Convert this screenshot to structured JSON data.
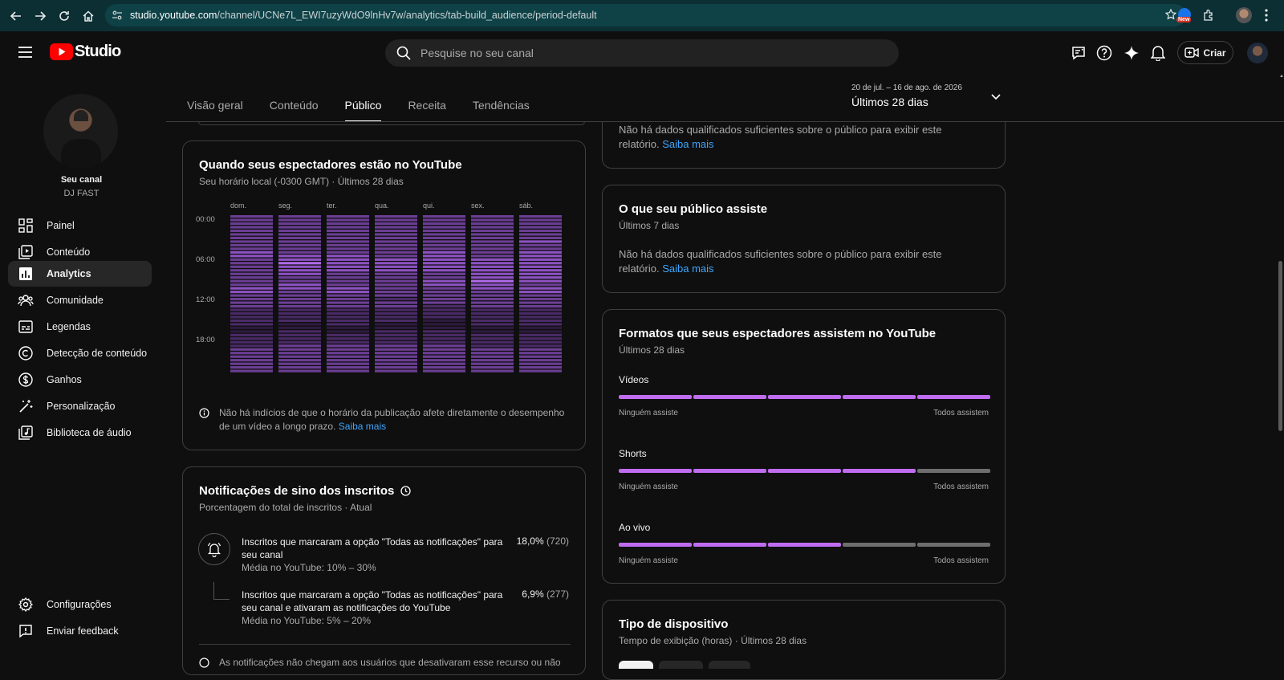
{
  "browser": {
    "url_host": "studio.youtube.com",
    "url_path": "/channel/UCNe7L_EWI7uzyWdO9lnHv7w/analytics/tab-build_audience/period-default",
    "ext_badge": "New"
  },
  "header": {
    "logo_text": "Studio",
    "search_placeholder": "Pesquise no seu canal",
    "create_label": "Criar"
  },
  "channel": {
    "label": "Seu canal",
    "name": "DJ FAST"
  },
  "sidebar": {
    "items": [
      {
        "label": "Painel",
        "icon": "dashboard-icon"
      },
      {
        "label": "Conteúdo",
        "icon": "content-icon"
      },
      {
        "label": "Analytics",
        "icon": "analytics-icon",
        "active": true
      },
      {
        "label": "Comunidade",
        "icon": "community-icon"
      },
      {
        "label": "Legendas",
        "icon": "subtitles-icon"
      },
      {
        "label": "Detecção de conteúdo",
        "icon": "copyright-icon"
      },
      {
        "label": "Ganhos",
        "icon": "earn-icon"
      },
      {
        "label": "Personalização",
        "icon": "customization-icon"
      },
      {
        "label": "Biblioteca de áudio",
        "icon": "audio-library-icon"
      }
    ],
    "bottom": [
      {
        "label": "Configurações",
        "icon": "settings-icon"
      },
      {
        "label": "Enviar feedback",
        "icon": "feedback-icon"
      }
    ]
  },
  "tabs": [
    {
      "label": "Visão geral"
    },
    {
      "label": "Conteúdo"
    },
    {
      "label": "Público",
      "active": true
    },
    {
      "label": "Receita"
    },
    {
      "label": "Tendências"
    }
  ],
  "period": {
    "range": "20 de jul. – 16 de ago. de 2026",
    "label": "Últimos 28 dias"
  },
  "when_card": {
    "title": "Quando seus espectadores estão no YouTube",
    "subtitle": "Seu horário local (-0300 GMT) · Últimos 28 dias",
    "days": [
      "dom.",
      "seg.",
      "ter.",
      "qua.",
      "qui.",
      "sex.",
      "sáb."
    ],
    "hours": [
      "00:00",
      "06:00",
      "12:00",
      "18:00"
    ],
    "note": "Não há indícios de que o horário da publicação afete diretamente o desempenho de um vídeo a longo prazo.",
    "link": "Saiba mais"
  },
  "heatmap_levels": [
    [
      3,
      3,
      3,
      3,
      3,
      3,
      3,
      3,
      3,
      3,
      4,
      4,
      3,
      3,
      3,
      3,
      3,
      3,
      3,
      3,
      4,
      4,
      3,
      3,
      3,
      3,
      2,
      2,
      2,
      2,
      2,
      1,
      1,
      2,
      2,
      2,
      2,
      3,
      3,
      3,
      3,
      3,
      3,
      3
    ],
    [
      3,
      3,
      3,
      3,
      3,
      3,
      3,
      3,
      3,
      3,
      3,
      4,
      4,
      5,
      4,
      4,
      4,
      3,
      3,
      4,
      4,
      3,
      3,
      3,
      3,
      3,
      2,
      2,
      2,
      2,
      1,
      1,
      2,
      2,
      2,
      2,
      3,
      3,
      3,
      3,
      3,
      3,
      3,
      3
    ],
    [
      3,
      3,
      3,
      3,
      3,
      3,
      3,
      3,
      3,
      3,
      3,
      4,
      4,
      4,
      4,
      4,
      3,
      3,
      3,
      3,
      4,
      4,
      3,
      3,
      3,
      3,
      2,
      2,
      2,
      2,
      2,
      1,
      1,
      2,
      2,
      2,
      3,
      3,
      3,
      3,
      3,
      3,
      3,
      3
    ],
    [
      3,
      3,
      3,
      3,
      3,
      3,
      3,
      3,
      3,
      3,
      3,
      3,
      4,
      4,
      4,
      4,
      3,
      3,
      3,
      3,
      3,
      3,
      3,
      2,
      3,
      3,
      2,
      2,
      2,
      2,
      1,
      1,
      2,
      2,
      2,
      2,
      3,
      3,
      3,
      3,
      3,
      3,
      3,
      3
    ],
    [
      3,
      3,
      3,
      3,
      3,
      3,
      3,
      3,
      3,
      3,
      4,
      4,
      4,
      4,
      4,
      4,
      3,
      3,
      4,
      4,
      3,
      3,
      3,
      3,
      3,
      2,
      2,
      2,
      2,
      1,
      1,
      1,
      2,
      2,
      2,
      2,
      3,
      3,
      3,
      3,
      3,
      3,
      3,
      3
    ],
    [
      3,
      3,
      3,
      3,
      3,
      3,
      3,
      3,
      3,
      3,
      3,
      3,
      4,
      4,
      4,
      4,
      4,
      4,
      5,
      4,
      4,
      3,
      3,
      3,
      3,
      3,
      2,
      2,
      2,
      2,
      2,
      1,
      1,
      2,
      2,
      2,
      2,
      3,
      3,
      3,
      3,
      3,
      3,
      3
    ],
    [
      3,
      3,
      3,
      3,
      3,
      3,
      3,
      4,
      3,
      3,
      4,
      4,
      4,
      4,
      4,
      4,
      4,
      4,
      4,
      3,
      4,
      4,
      3,
      3,
      3,
      3,
      2,
      2,
      2,
      2,
      2,
      1,
      1,
      2,
      2,
      2,
      2,
      3,
      3,
      3,
      3,
      3,
      3,
      3
    ]
  ],
  "bell_card": {
    "title": "Notificações de sino dos inscritos",
    "subtitle": "Porcentagem do total de inscritos · Atual",
    "rows": [
      {
        "line1": "Inscritos que marcaram a opção \"Todas as notificações\" para",
        "line2": "seu canal",
        "avg": "Média no YouTube: 10% – 30%",
        "pct": "18,0%",
        "count": "(720)"
      },
      {
        "line1": "Inscritos que marcaram a opção \"Todas as notificações\" para",
        "line2": "seu canal e ativaram as notificações do YouTube",
        "avg": "Média no YouTube: 5% – 20%",
        "pct": "6,9%",
        "count": "(277)"
      }
    ],
    "footer": "As notificações não chegam aos usuários que desativaram esse recurso ou não"
  },
  "nodata_card1": {
    "text1": "Não há dados qualificados suficientes sobre o público para exibir este",
    "text2": "relatório.",
    "link": "Saiba mais"
  },
  "watch_card": {
    "title": "O que seu público assiste",
    "subtitle": "Últimos 7 dias",
    "text1": "Não há dados qualificados suficientes sobre o público para exibir este",
    "text2": "relatório.",
    "link": "Saiba mais"
  },
  "formats_card": {
    "title": "Formatos que seus espectadores assistem no YouTube",
    "subtitle": "Últimos 28 dias",
    "formats": [
      {
        "label": "Vídeos",
        "filled_segments": 5,
        "min": "Ninguém assiste",
        "max": "Todos assistem"
      },
      {
        "label": "Shorts",
        "filled_segments": 4,
        "min": "Ninguém assiste",
        "max": "Todos assistem"
      },
      {
        "label": "Ao vivo",
        "filled_segments": 3,
        "min": "Ninguém assiste",
        "max": "Todos assistem"
      }
    ],
    "total_segments": 5
  },
  "device_card": {
    "title": "Tipo de dispositivo",
    "subtitle": "Tempo de exibição (horas) · Últimos 28 dias"
  },
  "colors": {
    "accent": "#3ea6ff",
    "bar_fill": "#c06cf0",
    "bar_empty": "#6e6e6e",
    "heat": [
      "#1a1024",
      "#2d1a3d",
      "#4a2a66",
      "#6b3e94",
      "#8d52c2",
      "#b06ae8"
    ]
  }
}
